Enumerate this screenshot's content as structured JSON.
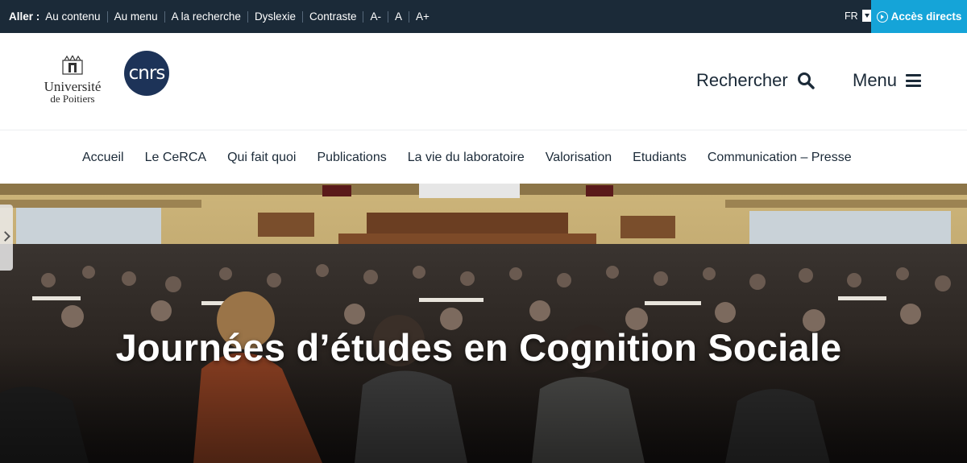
{
  "topbar": {
    "lead": "Aller :",
    "links": [
      "Au contenu",
      "Au menu",
      "A la recherche",
      "Dyslexie",
      "Contraste",
      "A-",
      "A",
      "A+"
    ],
    "lang": "FR",
    "direct_label": "Accès directs",
    "bg_color": "#1b2a38",
    "accent_color": "#15a4d8"
  },
  "header": {
    "logo_up": {
      "line1": "Université",
      "line2": "de Poitiers"
    },
    "logo_cnrs": "cnrs",
    "search_label": "Rechercher",
    "menu_label": "Menu"
  },
  "nav": {
    "items": [
      "Accueil",
      "Le CeRCA",
      "Qui fait quoi",
      "Publications",
      "La vie du laboratoire",
      "Valorisation",
      "Etudiants",
      "Communication – Presse"
    ]
  },
  "hero": {
    "title": "Journées d’études en Cognition Sociale"
  }
}
